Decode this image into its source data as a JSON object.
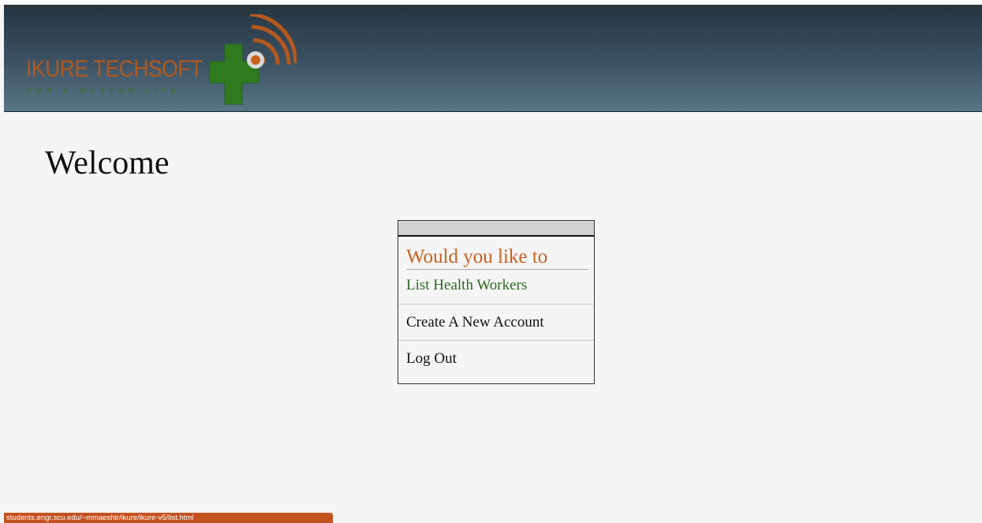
{
  "header": {
    "logo": {
      "brand_name": "IKURE TECHSOFT",
      "tagline": "FOR A BETTER LIFE",
      "icon": "medical-cross-wifi-icon"
    }
  },
  "main": {
    "title": "Welcome",
    "menu": {
      "prompt": "Would you like to",
      "items": [
        {
          "label": "List Health Workers",
          "color": "#2b6a1f"
        },
        {
          "label": "Create A New Account",
          "color": "#111111"
        },
        {
          "label": "Log Out",
          "color": "#111111"
        }
      ]
    }
  },
  "status_bar": {
    "url": "students.engr.scu.edu/~mmaeshir/ikure/ikure-v5/list.html"
  },
  "colors": {
    "accent_orange": "#c8611c",
    "link_green": "#2b6a1f",
    "header_dark": "#25343f",
    "status_bar": "#c4521e"
  }
}
